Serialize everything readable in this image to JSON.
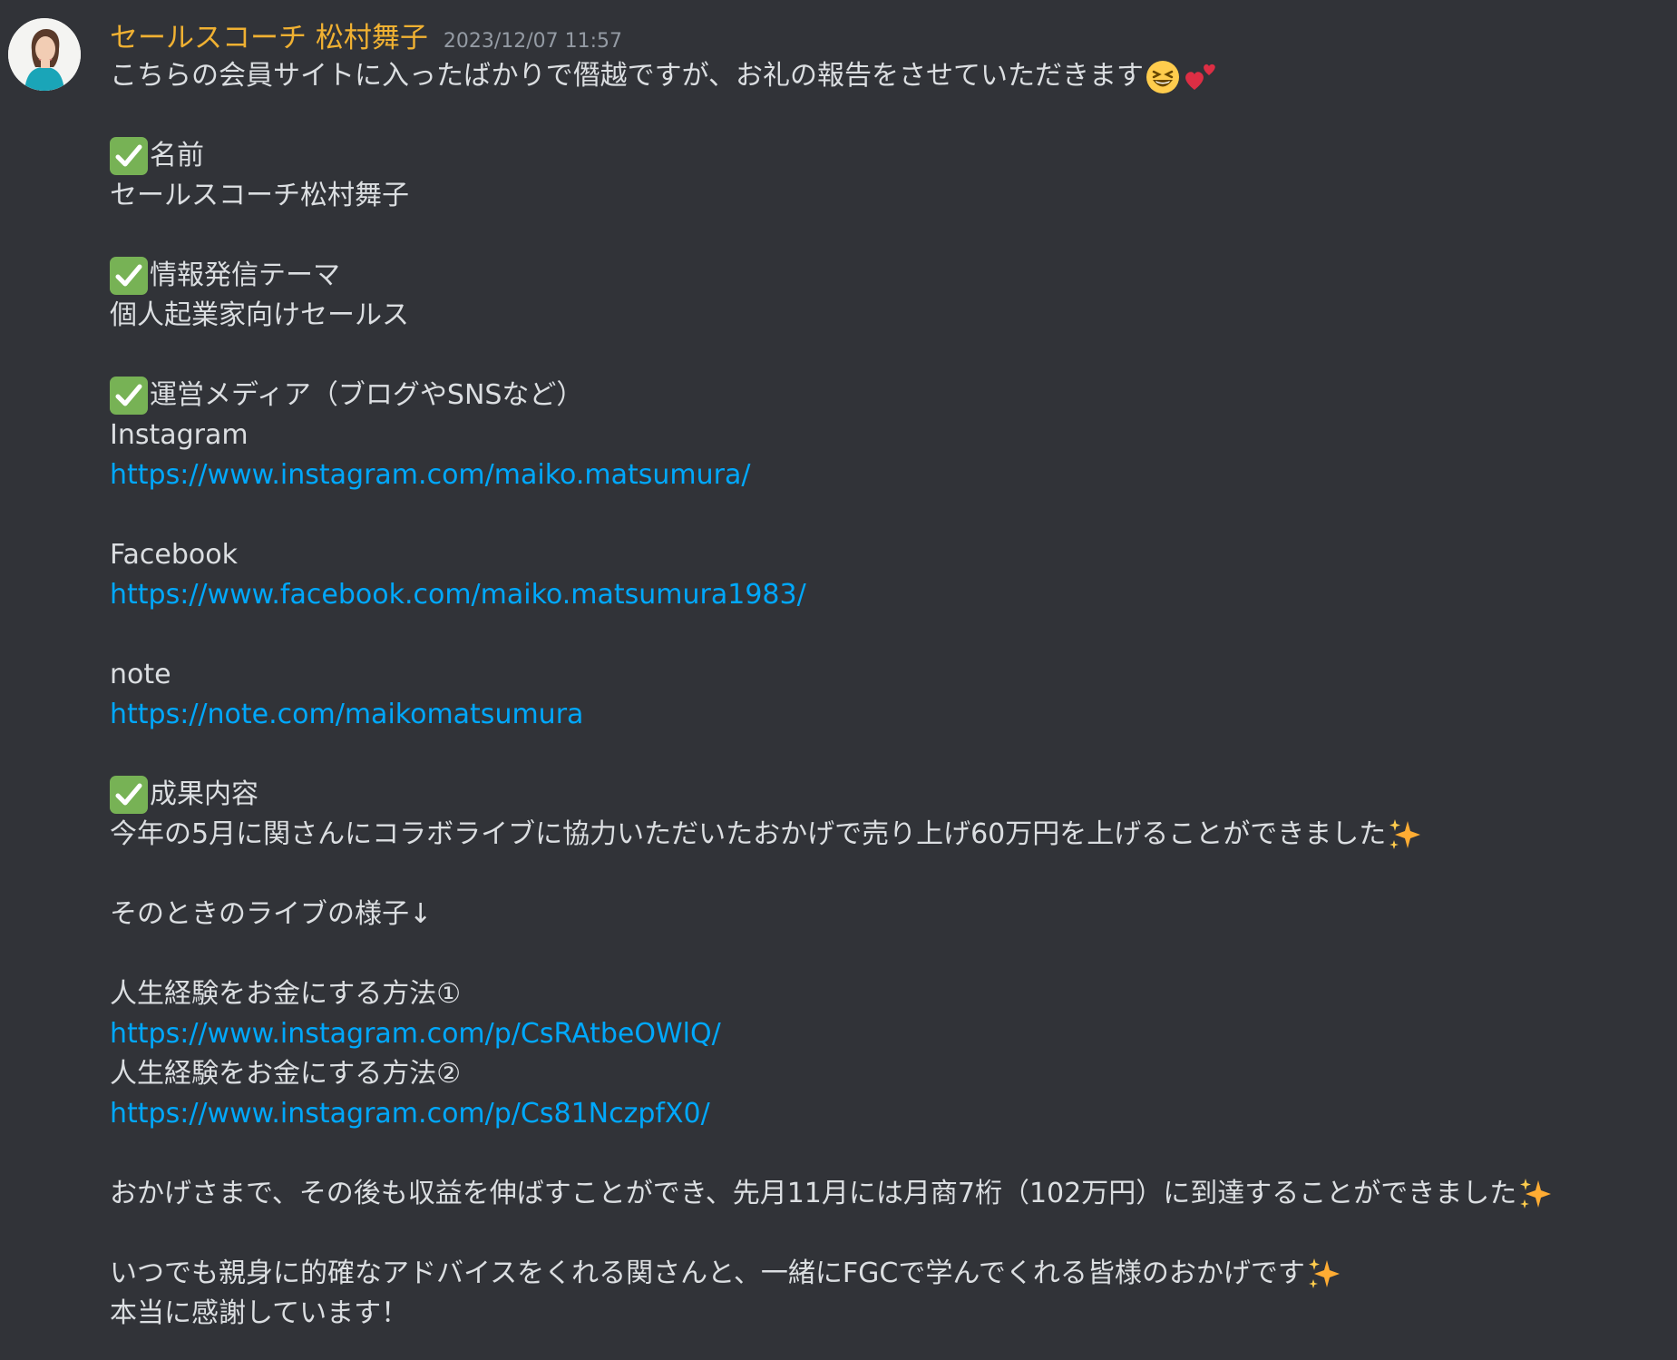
{
  "message": {
    "author": "セールスコーチ 松村舞子",
    "timestamp": "2023/12/07 11:57",
    "author_color": "#f0b132",
    "avatar_icon": "avatar-photo",
    "lines": {
      "intro": "こちらの会員サイトに入ったばかりで僭越ですが、お礼の報告をさせていただきます",
      "name_heading": "名前",
      "name_value": "セールスコーチ松村舞子",
      "theme_heading": "情報発信テーマ",
      "theme_value": "個人起業家向けセールス",
      "media_heading": "運営メディア（ブログやSNSなど）",
      "instagram_label": "Instagram",
      "instagram_url": "https://www.instagram.com/maiko.matsumura/",
      "facebook_label": "Facebook",
      "facebook_url": "https://www.facebook.com/maiko.matsumura1983/",
      "note_label": "note",
      "note_url": "https://note.com/maikomatsumura",
      "result_heading": "成果内容",
      "result_text": "今年の5月に関さんにコラボライブに協力いただいたおかげで売り上げ60万円を上げることができました",
      "live_text": "そのときのライブの様子↓",
      "method1_label": "人生経験をお金にする方法①",
      "method1_url": "https://www.instagram.com/p/CsRAtbeOWlQ/",
      "method2_label": "人生経験をお金にする方法②",
      "method2_url": "https://www.instagram.com/p/Cs81NczpfX0/",
      "growth_text": "おかげさまで、その後も収益を伸ばすことができ、先月11月には月商7桁（102万円）に到達することができました",
      "thanks_text": "いつでも親身に的確なアドバイスをくれる関さんと、一緒にFGCで学んでくれる皆様のおかげです",
      "closing_text": "本当に感謝しています！"
    },
    "emoji_icons": [
      "laughing-face-emoji",
      "two-hearts-emoji",
      "check-mark-button-emoji",
      "sparkles-emoji"
    ],
    "link_color": "#00a8fc"
  }
}
